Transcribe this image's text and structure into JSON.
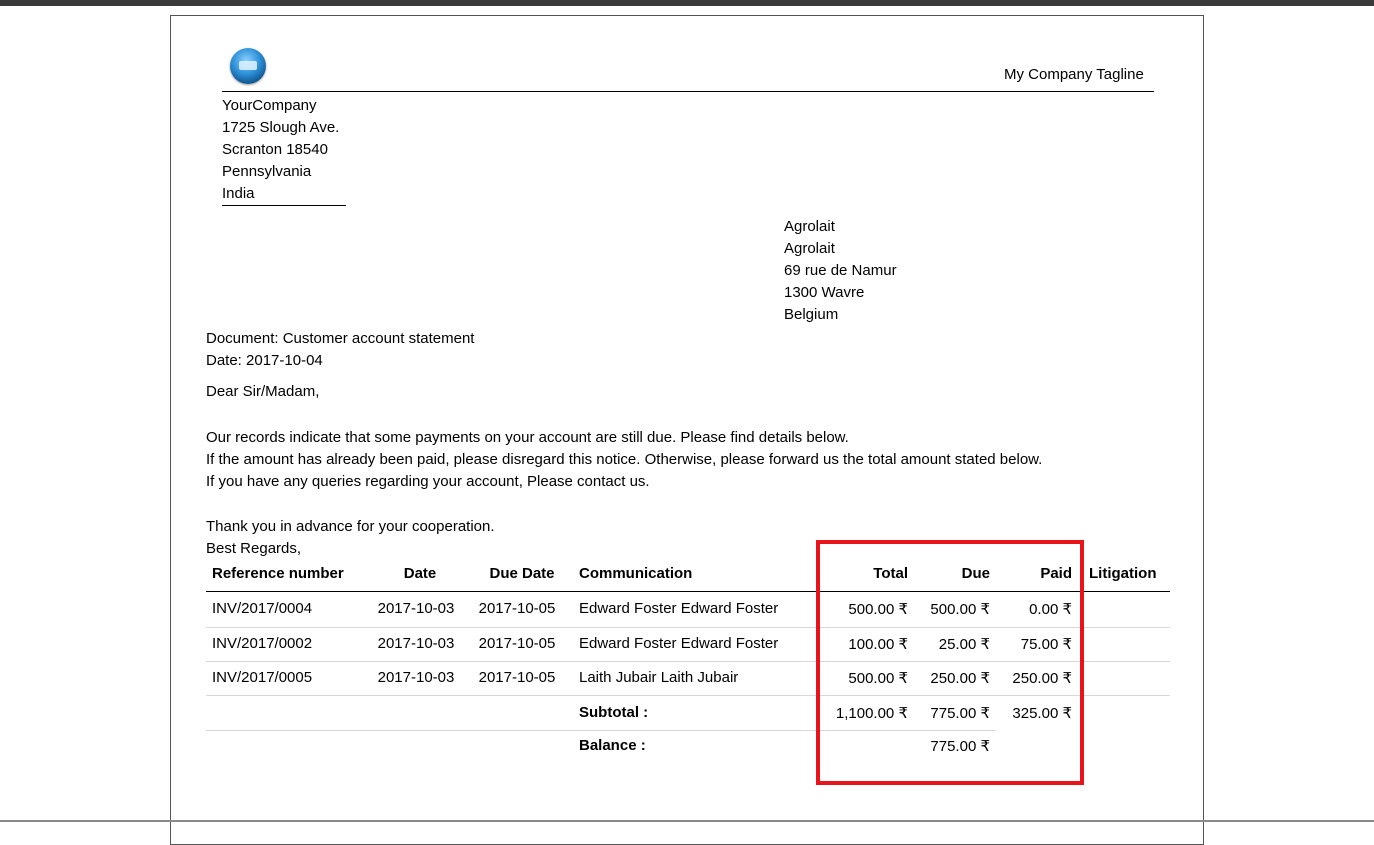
{
  "header": {
    "tagline": "My Company Tagline",
    "logo_icon": "company-logo-icon"
  },
  "company": {
    "lines": [
      "YourCompany",
      "1725 Slough Ave.",
      "Scranton 18540",
      "Pennsylvania",
      "India"
    ]
  },
  "partner": {
    "lines": [
      "Agrolait",
      "Agrolait",
      "69 rue de Namur",
      "1300 Wavre",
      "Belgium"
    ]
  },
  "document": {
    "title_line": "Document: Customer account statement",
    "date_line": "Date: 2017-10-04",
    "salutation": "Dear Sir/Madam,",
    "message_lines": [
      "Our records indicate that some payments on your account are still due. Please find details below.",
      "If the amount has already been paid, please disregard this notice. Otherwise, please forward us the total amount stated below.",
      "If you have any queries regarding your account, Please contact us."
    ],
    "closing_lines": [
      "Thank you in advance for your cooperation.",
      "Best Regards,"
    ]
  },
  "table": {
    "headers": {
      "reference": "Reference number",
      "date": "Date",
      "due_date": "Due Date",
      "communication": "Communication",
      "total": "Total",
      "due": "Due",
      "paid": "Paid",
      "litigation": "Litigation"
    },
    "rows": [
      {
        "reference": "INV/2017/0004",
        "date": "2017-10-03",
        "due_date": "2017-10-05",
        "communication": "Edward Foster Edward Foster",
        "total": "500.00 ₹",
        "due": "500.00 ₹",
        "paid": "0.00 ₹"
      },
      {
        "reference": "INV/2017/0002",
        "date": "2017-10-03",
        "due_date": "2017-10-05",
        "communication": "Edward Foster Edward Foster",
        "total": "100.00 ₹",
        "due": "25.00 ₹",
        "paid": "75.00 ₹"
      },
      {
        "reference": "INV/2017/0005",
        "date": "2017-10-03",
        "due_date": "2017-10-05",
        "communication": "Laith Jubair Laith Jubair",
        "total": "500.00 ₹",
        "due": "250.00 ₹",
        "paid": "250.00 ₹"
      }
    ],
    "subtotal": {
      "label": "Subtotal :",
      "total": "1,100.00 ₹",
      "due": "775.00 ₹",
      "paid": "325.00 ₹"
    },
    "balance": {
      "label": "Balance :",
      "due": "775.00 ₹"
    }
  },
  "annotation": {
    "highlight_color": "#e8141b"
  }
}
